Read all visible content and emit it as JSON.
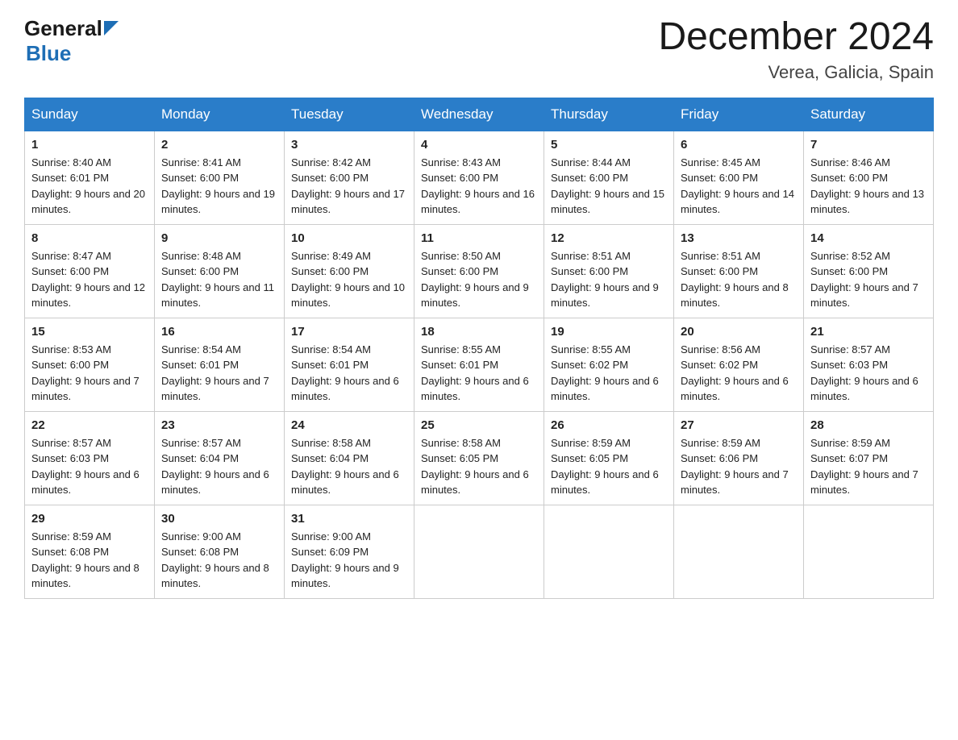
{
  "header": {
    "logo_general": "General",
    "logo_blue": "Blue",
    "month_title": "December 2024",
    "location": "Verea, Galicia, Spain"
  },
  "days_of_week": [
    "Sunday",
    "Monday",
    "Tuesday",
    "Wednesday",
    "Thursday",
    "Friday",
    "Saturday"
  ],
  "weeks": [
    [
      {
        "date": "1",
        "sunrise": "Sunrise: 8:40 AM",
        "sunset": "Sunset: 6:01 PM",
        "daylight": "Daylight: 9 hours and 20 minutes."
      },
      {
        "date": "2",
        "sunrise": "Sunrise: 8:41 AM",
        "sunset": "Sunset: 6:00 PM",
        "daylight": "Daylight: 9 hours and 19 minutes."
      },
      {
        "date": "3",
        "sunrise": "Sunrise: 8:42 AM",
        "sunset": "Sunset: 6:00 PM",
        "daylight": "Daylight: 9 hours and 17 minutes."
      },
      {
        "date": "4",
        "sunrise": "Sunrise: 8:43 AM",
        "sunset": "Sunset: 6:00 PM",
        "daylight": "Daylight: 9 hours and 16 minutes."
      },
      {
        "date": "5",
        "sunrise": "Sunrise: 8:44 AM",
        "sunset": "Sunset: 6:00 PM",
        "daylight": "Daylight: 9 hours and 15 minutes."
      },
      {
        "date": "6",
        "sunrise": "Sunrise: 8:45 AM",
        "sunset": "Sunset: 6:00 PM",
        "daylight": "Daylight: 9 hours and 14 minutes."
      },
      {
        "date": "7",
        "sunrise": "Sunrise: 8:46 AM",
        "sunset": "Sunset: 6:00 PM",
        "daylight": "Daylight: 9 hours and 13 minutes."
      }
    ],
    [
      {
        "date": "8",
        "sunrise": "Sunrise: 8:47 AM",
        "sunset": "Sunset: 6:00 PM",
        "daylight": "Daylight: 9 hours and 12 minutes."
      },
      {
        "date": "9",
        "sunrise": "Sunrise: 8:48 AM",
        "sunset": "Sunset: 6:00 PM",
        "daylight": "Daylight: 9 hours and 11 minutes."
      },
      {
        "date": "10",
        "sunrise": "Sunrise: 8:49 AM",
        "sunset": "Sunset: 6:00 PM",
        "daylight": "Daylight: 9 hours and 10 minutes."
      },
      {
        "date": "11",
        "sunrise": "Sunrise: 8:50 AM",
        "sunset": "Sunset: 6:00 PM",
        "daylight": "Daylight: 9 hours and 9 minutes."
      },
      {
        "date": "12",
        "sunrise": "Sunrise: 8:51 AM",
        "sunset": "Sunset: 6:00 PM",
        "daylight": "Daylight: 9 hours and 9 minutes."
      },
      {
        "date": "13",
        "sunrise": "Sunrise: 8:51 AM",
        "sunset": "Sunset: 6:00 PM",
        "daylight": "Daylight: 9 hours and 8 minutes."
      },
      {
        "date": "14",
        "sunrise": "Sunrise: 8:52 AM",
        "sunset": "Sunset: 6:00 PM",
        "daylight": "Daylight: 9 hours and 7 minutes."
      }
    ],
    [
      {
        "date": "15",
        "sunrise": "Sunrise: 8:53 AM",
        "sunset": "Sunset: 6:00 PM",
        "daylight": "Daylight: 9 hours and 7 minutes."
      },
      {
        "date": "16",
        "sunrise": "Sunrise: 8:54 AM",
        "sunset": "Sunset: 6:01 PM",
        "daylight": "Daylight: 9 hours and 7 minutes."
      },
      {
        "date": "17",
        "sunrise": "Sunrise: 8:54 AM",
        "sunset": "Sunset: 6:01 PM",
        "daylight": "Daylight: 9 hours and 6 minutes."
      },
      {
        "date": "18",
        "sunrise": "Sunrise: 8:55 AM",
        "sunset": "Sunset: 6:01 PM",
        "daylight": "Daylight: 9 hours and 6 minutes."
      },
      {
        "date": "19",
        "sunrise": "Sunrise: 8:55 AM",
        "sunset": "Sunset: 6:02 PM",
        "daylight": "Daylight: 9 hours and 6 minutes."
      },
      {
        "date": "20",
        "sunrise": "Sunrise: 8:56 AM",
        "sunset": "Sunset: 6:02 PM",
        "daylight": "Daylight: 9 hours and 6 minutes."
      },
      {
        "date": "21",
        "sunrise": "Sunrise: 8:57 AM",
        "sunset": "Sunset: 6:03 PM",
        "daylight": "Daylight: 9 hours and 6 minutes."
      }
    ],
    [
      {
        "date": "22",
        "sunrise": "Sunrise: 8:57 AM",
        "sunset": "Sunset: 6:03 PM",
        "daylight": "Daylight: 9 hours and 6 minutes."
      },
      {
        "date": "23",
        "sunrise": "Sunrise: 8:57 AM",
        "sunset": "Sunset: 6:04 PM",
        "daylight": "Daylight: 9 hours and 6 minutes."
      },
      {
        "date": "24",
        "sunrise": "Sunrise: 8:58 AM",
        "sunset": "Sunset: 6:04 PM",
        "daylight": "Daylight: 9 hours and 6 minutes."
      },
      {
        "date": "25",
        "sunrise": "Sunrise: 8:58 AM",
        "sunset": "Sunset: 6:05 PM",
        "daylight": "Daylight: 9 hours and 6 minutes."
      },
      {
        "date": "26",
        "sunrise": "Sunrise: 8:59 AM",
        "sunset": "Sunset: 6:05 PM",
        "daylight": "Daylight: 9 hours and 6 minutes."
      },
      {
        "date": "27",
        "sunrise": "Sunrise: 8:59 AM",
        "sunset": "Sunset: 6:06 PM",
        "daylight": "Daylight: 9 hours and 7 minutes."
      },
      {
        "date": "28",
        "sunrise": "Sunrise: 8:59 AM",
        "sunset": "Sunset: 6:07 PM",
        "daylight": "Daylight: 9 hours and 7 minutes."
      }
    ],
    [
      {
        "date": "29",
        "sunrise": "Sunrise: 8:59 AM",
        "sunset": "Sunset: 6:08 PM",
        "daylight": "Daylight: 9 hours and 8 minutes."
      },
      {
        "date": "30",
        "sunrise": "Sunrise: 9:00 AM",
        "sunset": "Sunset: 6:08 PM",
        "daylight": "Daylight: 9 hours and 8 minutes."
      },
      {
        "date": "31",
        "sunrise": "Sunrise: 9:00 AM",
        "sunset": "Sunset: 6:09 PM",
        "daylight": "Daylight: 9 hours and 9 minutes."
      },
      {
        "date": "",
        "sunrise": "",
        "sunset": "",
        "daylight": ""
      },
      {
        "date": "",
        "sunrise": "",
        "sunset": "",
        "daylight": ""
      },
      {
        "date": "",
        "sunrise": "",
        "sunset": "",
        "daylight": ""
      },
      {
        "date": "",
        "sunrise": "",
        "sunset": "",
        "daylight": ""
      }
    ]
  ]
}
